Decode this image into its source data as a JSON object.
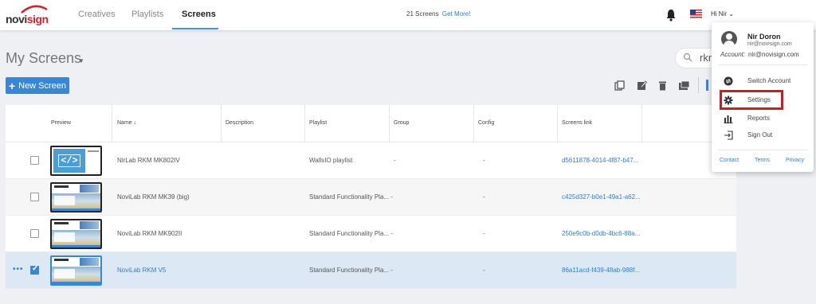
{
  "brand": {
    "logo_prefix": "novi",
    "logo_suffix": "sign",
    "accent_color": "#d8222a",
    "primary_color": "#3a86d6"
  },
  "topbar": {
    "tabs": [
      {
        "label": "Creatives",
        "active": false
      },
      {
        "label": "Playlists",
        "active": false
      },
      {
        "label": "Screens",
        "active": true
      }
    ],
    "screens_count": "21 Screens",
    "get_more": "Get More!",
    "greeting": "Hi Nir",
    "icons": [
      "bell-icon",
      "us-flag-icon",
      "chevron-down-icon"
    ]
  },
  "header": {
    "title": "My Screens",
    "new_screen_label": "New Screen",
    "search_value": "rkm",
    "toolbar_icons": [
      "copy-icon",
      "edit-icon",
      "delete-icon",
      "move-icon",
      "more-icon"
    ]
  },
  "table": {
    "columns": [
      "Preview",
      "Name ↓",
      "Description",
      "Playlist",
      "Group",
      "Config",
      "Screens link"
    ],
    "rows": [
      {
        "name": "NirLab RKM MK802IV",
        "description": "",
        "playlist": "WallsIO playlist",
        "group": "-",
        "config": "-",
        "link": "d5611878-4014-4f87-b47...",
        "checked": false,
        "thumb": "code",
        "selected": false
      },
      {
        "name": "NoviLab RKM MK39 (big)",
        "description": "",
        "playlist": "Standard Functionality Pla... -",
        "group": "",
        "config": "-",
        "link": "c425d327-b0e1-49a1-a62...",
        "checked": false,
        "thumb": "standard",
        "selected": false
      },
      {
        "name": "NoviLab RKM MK902II",
        "description": "",
        "playlist": "Standard Functionality Pla... -",
        "group": "",
        "config": "-",
        "link": "250e9c0b-d0db-4bc6-88a...",
        "checked": false,
        "thumb": "standard",
        "selected": false
      },
      {
        "name": "NoviLab RKM V5",
        "description": "",
        "playlist": "Standard Functionality Pla... -",
        "group": "",
        "config": "-",
        "link": "86a11acd-f439-48ab-988f...",
        "checked": true,
        "thumb": "standard",
        "selected": true
      }
    ],
    "row_menu": "•••"
  },
  "user_menu": {
    "name": "Nir Doron",
    "email": "nir@novisign.com",
    "account_label": "Account:",
    "account_value": "nir@novisign.com",
    "items": [
      {
        "label": "Switch Account",
        "icon": "switch-account-icon"
      },
      {
        "label": "Settings",
        "icon": "gear-icon",
        "highlighted": true
      },
      {
        "label": "Reports",
        "icon": "reports-icon"
      },
      {
        "label": "Sign Out",
        "icon": "sign-out-icon"
      }
    ],
    "footer": {
      "contact": "Contact",
      "terms": "Terms",
      "privacy": "Privacy"
    },
    "highlight_color": "#d11a24"
  }
}
